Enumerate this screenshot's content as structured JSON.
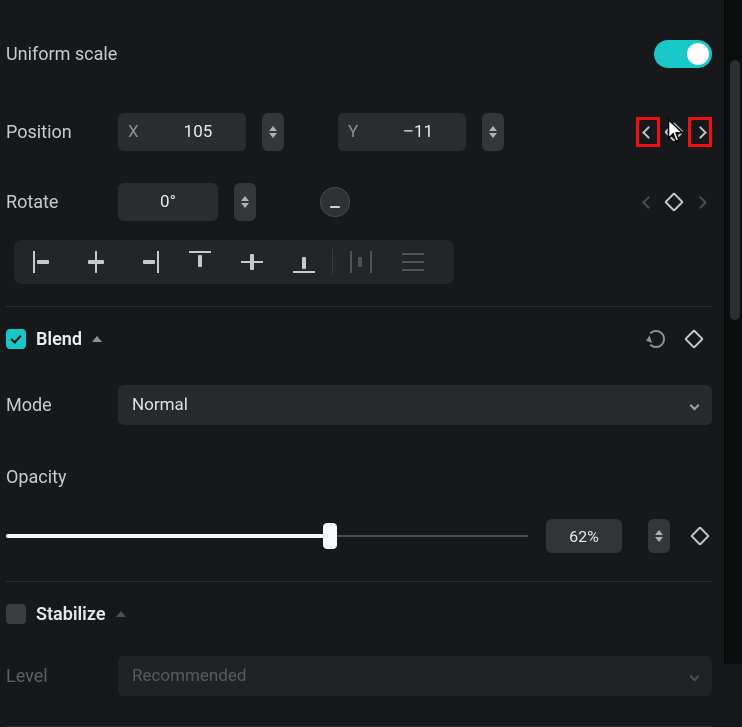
{
  "uniform_scale": {
    "label": "Uniform scale",
    "on": true
  },
  "position": {
    "label": "Position",
    "x_label": "X",
    "x_value": "105",
    "y_label": "Y",
    "y_value": "–11"
  },
  "rotate": {
    "label": "Rotate",
    "value": "0°"
  },
  "blend": {
    "title": "Blend",
    "mode_label": "Mode",
    "mode_value": "Normal",
    "opacity_label": "Opacity",
    "opacity_value": "62%",
    "opacity_pct": 62
  },
  "stabilize": {
    "title": "Stabilize",
    "level_label": "Level",
    "level_value": "Recommended"
  }
}
